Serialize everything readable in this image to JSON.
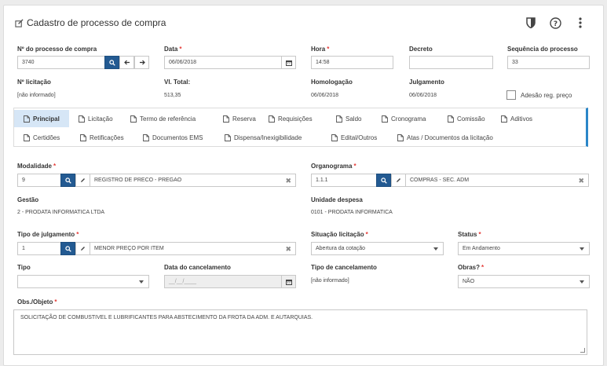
{
  "title": "Cadastro de processo de compra",
  "header": {
    "nr_processo": {
      "label": "Nº do processo de compra",
      "value": "3740"
    },
    "data": {
      "label": "Data",
      "value": "06/06/2018"
    },
    "hora": {
      "label": "Hora",
      "value": "14:58"
    },
    "decreto": {
      "label": "Decreto",
      "value": ""
    },
    "sequencia": {
      "label": "Sequência do processo",
      "value": "33"
    },
    "nr_licitacao": {
      "label": "Nº licitação",
      "value": "[não informado]"
    },
    "vl_total": {
      "label": "Vl. Total:",
      "value": "513,35"
    },
    "homologacao": {
      "label": "Homologação",
      "value": "06/06/2018"
    },
    "julgamento": {
      "label": "Julgamento",
      "value": "06/06/2018"
    },
    "adesao": {
      "label": "Adesão reg. preço",
      "checked": false
    }
  },
  "tabs_row1": [
    "Principal",
    "Licitação",
    "Termo de referência",
    "Reserva",
    "Requisições",
    "Saldo",
    "Cronograma",
    "Comissão",
    "Aditivos"
  ],
  "tabs_row2": [
    "Certidões",
    "Retificações",
    "Documentos EMS",
    "Dispensa/Inexigibilidade",
    "Edital/Outros",
    "Atas / Documentos da licitação"
  ],
  "form": {
    "modalidade": {
      "label": "Modalidade",
      "code": "9",
      "desc": "REGISTRO DE PRECO - PREGAO"
    },
    "organograma": {
      "label": "Organograma",
      "code": "1.1.1",
      "desc": "COMPRAS - SEC. ADM"
    },
    "gestao": {
      "label": "Gestão",
      "value": "2 - PRODATA INFORMATICA LTDA"
    },
    "unidade": {
      "label": "Unidade despesa",
      "value": "0101 - PRODATA INFORMATICA"
    },
    "tipo_julgamento": {
      "label": "Tipo de julgamento",
      "code": "1",
      "desc": "MENOR PREÇO POR ITEM"
    },
    "situacao": {
      "label": "Situação licitação",
      "value": "Abertura da cotação"
    },
    "status": {
      "label": "Status",
      "value": "Em Andamento"
    },
    "tipo": {
      "label": "Tipo",
      "value": ""
    },
    "data_cancel": {
      "label": "Data do cancelamento",
      "placeholder": "__/__/____"
    },
    "tipo_cancel": {
      "label": "Tipo de cancelamento",
      "value": "[não informado]"
    },
    "obras": {
      "label": "Obras?",
      "value": "NÃO"
    },
    "obs": {
      "label": "Obs./Objeto",
      "value": "SOLICITAÇÃO DE COMBUSTIVEL E LUBRIFICANTES PARA ABSTECIMENTO DA FROTA  DA ADM. E AUTARQUIAS."
    }
  },
  "colors": {
    "accent": "#235a92",
    "tab_active": "#d6e6f6",
    "required": "#e53935"
  },
  "icons": [
    "edit-icon",
    "shield-icon",
    "help-icon",
    "more-vertical-icon",
    "search-icon",
    "arrow-left-icon",
    "arrow-right-icon",
    "calendar-icon",
    "pencil-icon",
    "close-icon",
    "document-icon"
  ]
}
